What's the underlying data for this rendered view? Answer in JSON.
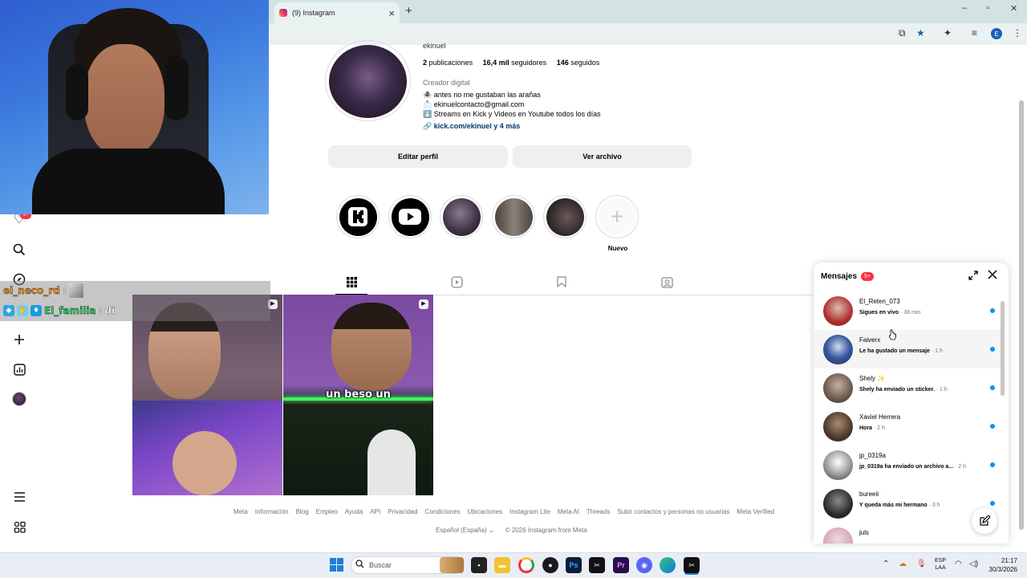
{
  "browser": {
    "tab_title": "(9) Instagram",
    "tab_close": "×",
    "new_tab": "+",
    "window_controls": [
      "–",
      "▫",
      "✕"
    ]
  },
  "chat": {
    "line1": {
      "user": "el_neco_rd",
      "sep": ":"
    },
    "line2": {
      "user": "El_familia",
      "sep": ":",
      "message": "di"
    }
  },
  "profile": {
    "username_partial": "ekinuel",
    "posts_count": "2",
    "posts_label": "publicaciones",
    "followers_count": "16,4 mil",
    "followers_label": "seguidores",
    "following_count": "146",
    "following_label": "seguidos",
    "category": "Creador digital",
    "bio": [
      "🕷️ antes no me gustaban las arañas",
      "📩 ekinuelcontacto@gmail.com",
      "⬇️ Streams en Kick y Videos en Youtube todos los días"
    ],
    "link": "🔗 kick.com/ekinuel y 4 más",
    "edit_button": "Editar perfil",
    "archive_button": "Ver archivo"
  },
  "highlights": {
    "new_label": "Nuevo",
    "items": [
      {
        "name": "kick",
        "color": "#000000"
      },
      {
        "name": "youtube",
        "color": "#000000"
      },
      {
        "name": "photo-1",
        "color": "#3b3140"
      },
      {
        "name": "photo-2",
        "color": "#6a6460"
      },
      {
        "name": "photo-3",
        "color": "#2a2424"
      }
    ]
  },
  "posts": {
    "caption": "un beso un"
  },
  "footer": {
    "links": [
      "Meta",
      "Información",
      "Blog",
      "Empleo",
      "Ayuda",
      "API",
      "Privacidad",
      "Condiciones",
      "Ubicaciones",
      "Instagram Lite",
      "Meta AI",
      "Threads",
      "Subir contactos y personas no usuarias",
      "Meta Verified"
    ],
    "language": "Español (España) ⌄",
    "copyright": "© 2026 Instagram from Meta"
  },
  "messages": {
    "title": "Mensajes",
    "badge": "9+",
    "conversations": [
      {
        "name": "El_Reten_073",
        "preview": "Sigues en vivo",
        "time": " · 38 min",
        "avatar": "#b03030"
      },
      {
        "name": "Faiverx",
        "preview": "Le ha gustado un mensaje",
        "time": " · 1 h",
        "avatar": "#1e2c55"
      },
      {
        "name": "Shely ✨",
        "preview": "Shely ha enviado un sticker.",
        "time": " · 1 h",
        "avatar": "#6b5a50"
      },
      {
        "name": "Xaviel Herrera",
        "preview": "Hora",
        "time": " · 2 h",
        "avatar": "#4a3a30"
      },
      {
        "name": "jp_0319a",
        "preview": "jp_0319a ha enviado un archivo a...",
        "time": " · 2 h",
        "avatar": "#9a9a9a"
      },
      {
        "name": "bureeii",
        "preview": "Y queda más mi hermano",
        "time": " · 3 h",
        "avatar": "#2c2c2c"
      },
      {
        "name": "juls",
        "preview": "",
        "time": "",
        "avatar": "#d8a8b8"
      }
    ]
  },
  "taskbar": {
    "search_placeholder": "Buscar",
    "lang_line1": "ESP",
    "lang_line2": "LAA",
    "time": "21:17",
    "date": "30/3/2026"
  },
  "rail": {
    "badge": "9+"
  }
}
